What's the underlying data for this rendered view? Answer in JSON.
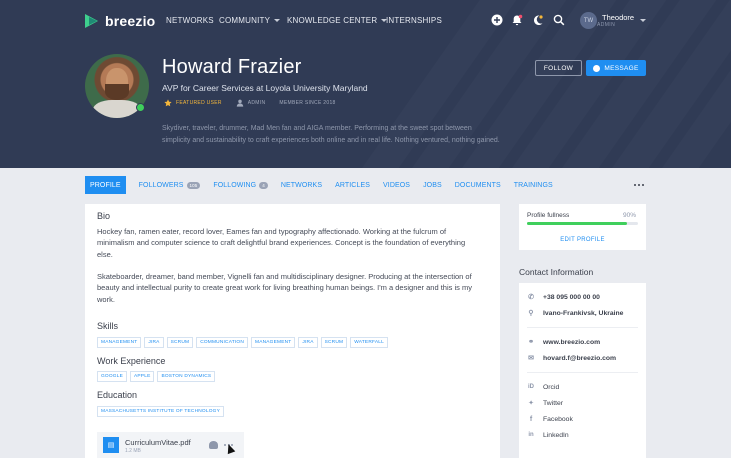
{
  "app": {
    "brand": "breezio"
  },
  "nav": {
    "links": [
      {
        "label": "NETWORKS",
        "dropdown": false
      },
      {
        "label": "COMMUNITY",
        "dropdown": true
      },
      {
        "label": "KNOWLEDGE CENTER",
        "dropdown": true
      },
      {
        "label": "INTERNSHIPS",
        "dropdown": false
      }
    ],
    "icons": [
      "add-icon",
      "notification-icon",
      "theme-icon",
      "search-icon"
    ],
    "user": {
      "initials": "TW",
      "name": "Theodore",
      "role": "ADMIN"
    }
  },
  "profile": {
    "name": "Howard Frazier",
    "title": "AVP for Career Services at Loyola University Maryland",
    "badges": {
      "featured": "FEATURED USER",
      "admin": "ADMIN",
      "since": "MEMBER SINCE 2018"
    },
    "short_bio": "Skydiver, traveler, drummer, Mad Men fan and AIGA member. Performing at the sweet spot between simplicity and sustainability to craft experiences both online and in real life. Nothing ventured, nothing gained.",
    "follow_label": "FOLLOW",
    "message_label": "MESSAGE",
    "online": true
  },
  "tabs": [
    {
      "label": "PROFILE",
      "active": true
    },
    {
      "label": "FOLLOWERS",
      "count": "105"
    },
    {
      "label": "FOLLOWING",
      "count": "4"
    },
    {
      "label": "NETWORKS"
    },
    {
      "label": "ARTICLES"
    },
    {
      "label": "VIDEOS"
    },
    {
      "label": "JOBS"
    },
    {
      "label": "DOCUMENTS"
    },
    {
      "label": "TRAININGS"
    }
  ],
  "bio": {
    "heading": "Bio",
    "p1": "Hockey fan, ramen eater, record lover, Eames fan and typography affectionado. Working at the fulcrum of minimalism and computer science to craft delightful brand experiences. Concept is the foundation of everything else.",
    "p2": "Skateboarder, dreamer, band member, Vignelli fan and multidisciplinary designer. Producing at the intersection of beauty and intellectual purity to create great work for living breathing human beings. I'm a designer and this is my work."
  },
  "skills": {
    "heading": "Skills",
    "items": [
      "MANAGEMENT",
      "JIRA",
      "SCRUM",
      "COMMUNICATION",
      "MANAGEMENT",
      "JIRA",
      "SCRUM",
      "WATERFALL"
    ]
  },
  "experience": {
    "heading": "Work Experience",
    "items": [
      "GOOGLE",
      "APPLE",
      "BOSTON DYNAMICS"
    ]
  },
  "education": {
    "heading": "Education",
    "items": [
      "MASSACHUSETTS INSTITUTE OF TECHNOLOGY"
    ]
  },
  "file": {
    "name": "CurriculumVitae.pdf",
    "size": "1.2 MB"
  },
  "profile_fullness": {
    "label": "Profile fullness",
    "value_text": "90%",
    "value": 0.9,
    "edit_label": "EDIT PROFILE"
  },
  "contact": {
    "heading": "Contact Information",
    "phone": "+38 095 000 00 00",
    "location": "Ivano-Frankivsk, Ukraine",
    "website": "www.breezio.com",
    "email": "hovard.f@breezio.com",
    "socials": [
      "Orcid",
      "Twitter",
      "Facebook",
      "LinkedIn"
    ]
  },
  "colors": {
    "header_bg": "#303b55",
    "accent": "#1f8ef1",
    "featured": "#f5b73b",
    "online": "#3fcf5c",
    "page_bg": "#e9ebf0"
  }
}
